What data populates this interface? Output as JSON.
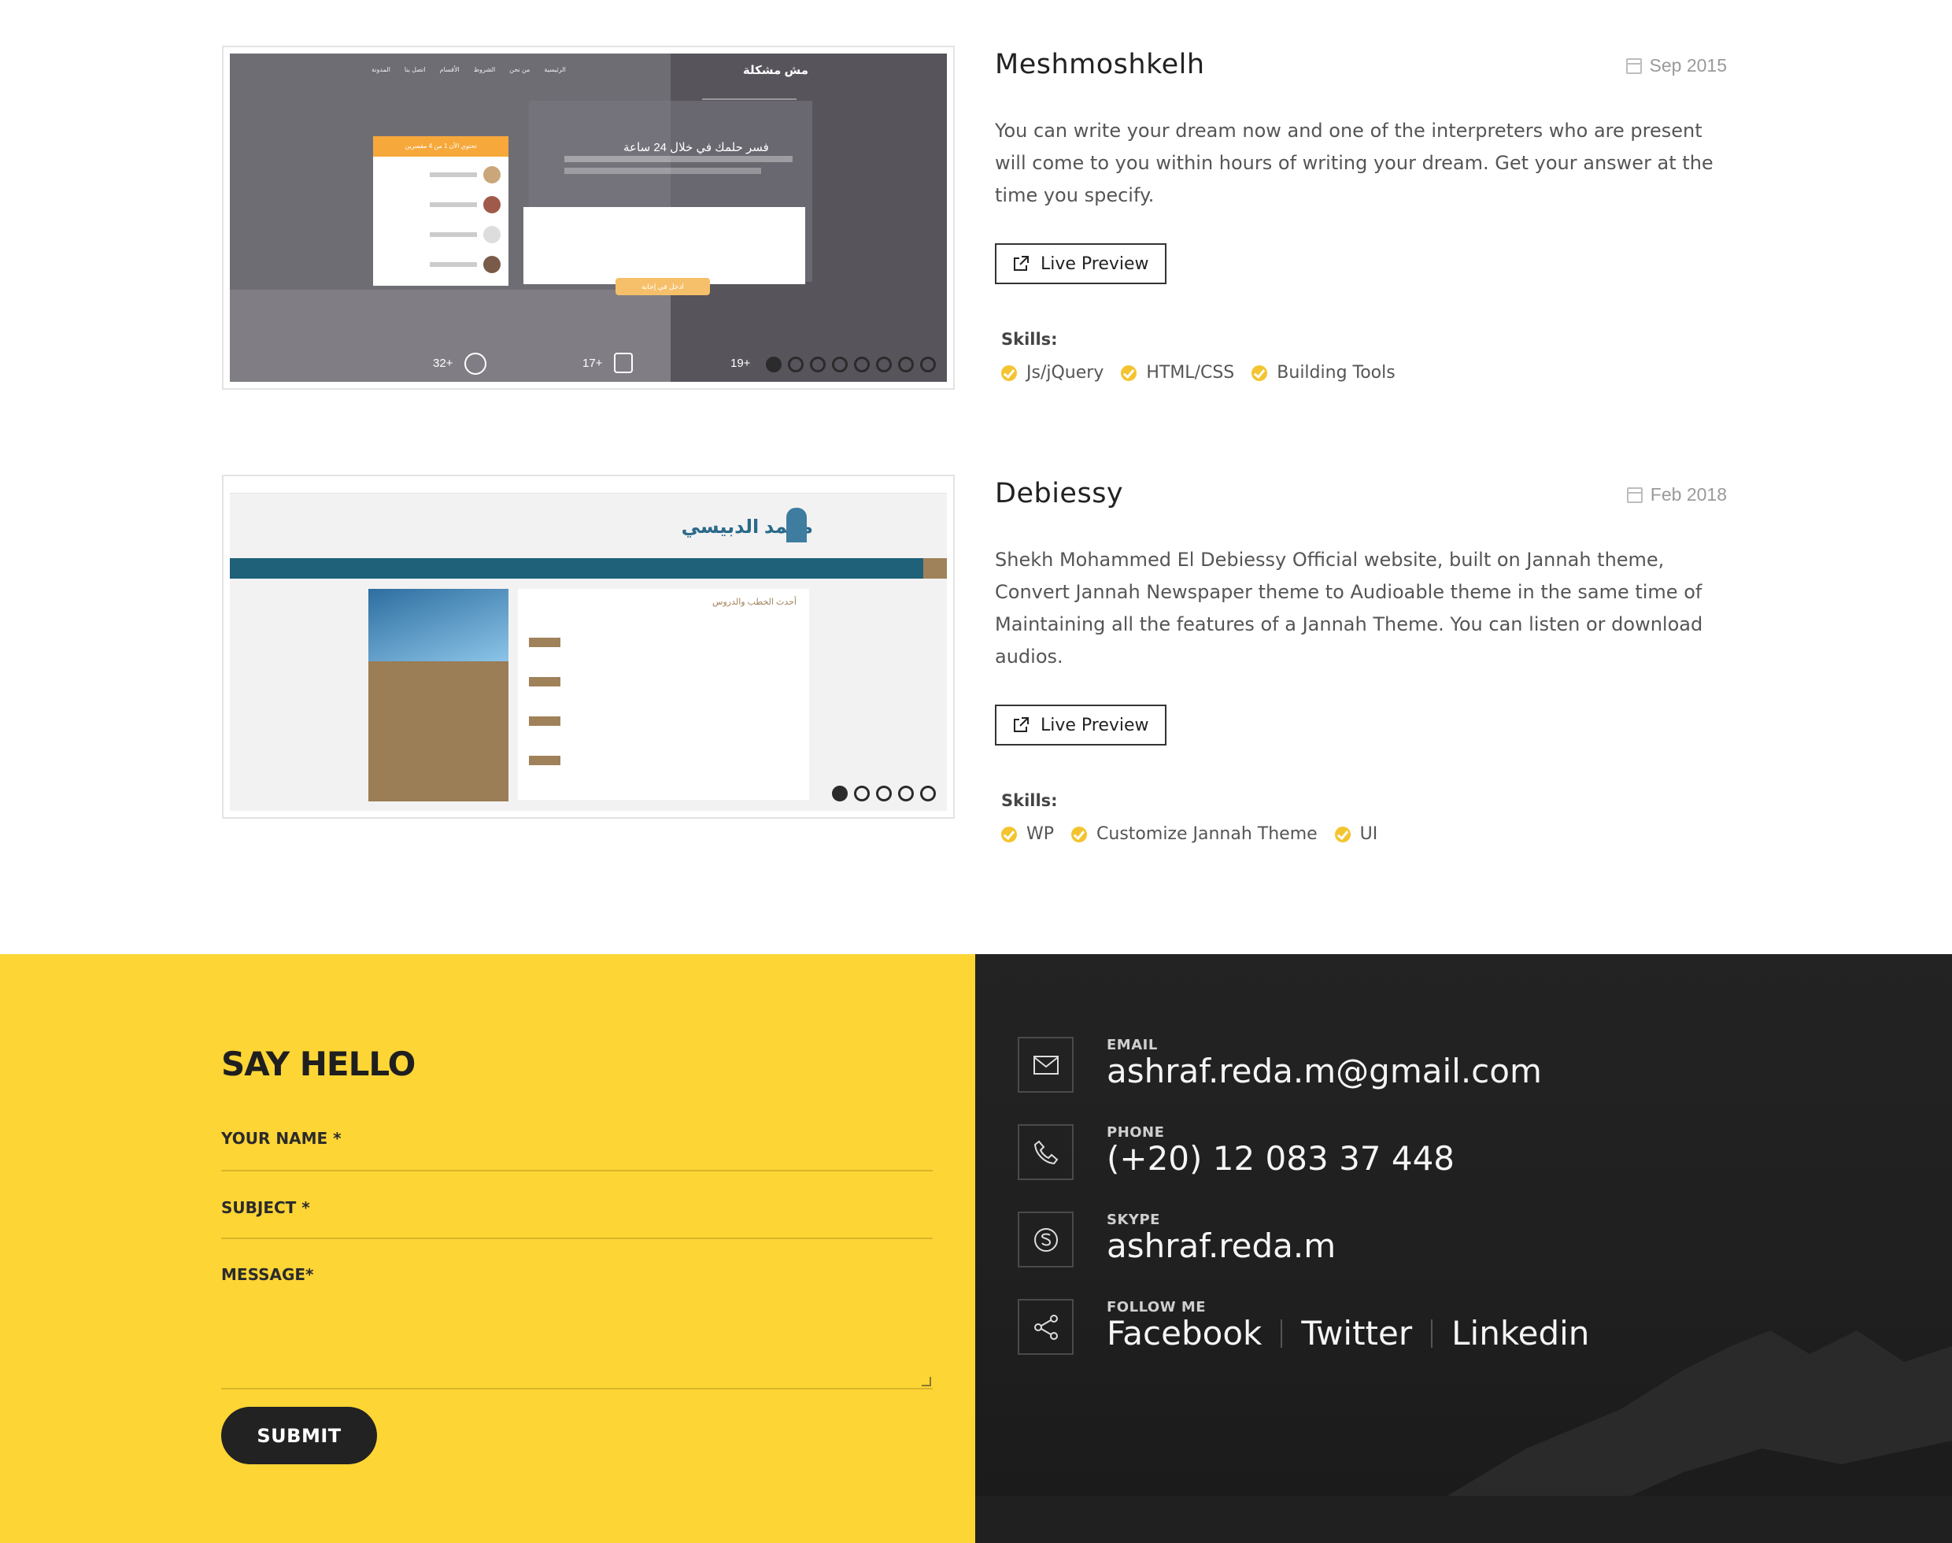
{
  "portfolio": [
    {
      "title": "Meshmoshkelh",
      "date": "Sep 2015",
      "description": "You can write your dream now and one of the interpreters who are present will come to you within hours of writing your dream. Get your answer at the time you specify.",
      "preview_label": "Live Preview",
      "skills_label": "Skills:",
      "skills": [
        "Js/jQuery",
        "HTML/CSS",
        "Building Tools"
      ],
      "screenshot": {
        "logo": "مش مشكلة",
        "nav": [
          "الرئيسية",
          "من نحن",
          "الشروط",
          "الأقسام",
          "اتصل بنا",
          "المدونة"
        ],
        "headline": "فسر حلمك في خلال 24 ساعة",
        "panel_title": "تحتوي الآن 1 من 4 مفسرين",
        "submit": "ادخل في إجابة",
        "stats": [
          "32+",
          "17+",
          "19+"
        ],
        "slide_dots": 8,
        "active_dot": 0
      }
    },
    {
      "title": "Debiessy",
      "date": "Feb 2018",
      "description": "Shekh Mohammed El Debiessy Official website, built on Jannah theme, Convert Jannah Newspaper theme to Audioable theme in the same time of Maintaining all the features of a Jannah Theme. You can listen or download audios.",
      "preview_label": "Live Preview",
      "skills_label": "Skills:",
      "skills": [
        "WP",
        "Customize Jannah Theme",
        "UI"
      ],
      "screenshot": {
        "logo": "محمد الدبيسي",
        "section_title": "أحدث الخطب والدروس",
        "slide_dots": 5,
        "active_dot": 0
      }
    }
  ],
  "contact_form": {
    "heading": "SAY HELLO",
    "name_label": "YOUR NAME *",
    "subject_label": "SUBJECT *",
    "message_label": "MESSAGE*",
    "submit_label": "SUBMIT"
  },
  "contact_info": {
    "email_label": "EMAIL",
    "email": "ashraf.reda.m@gmail.com",
    "phone_label": "PHONE",
    "phone": "(+20) 12 083 37 448",
    "skype_label": "SKYPE",
    "skype": "ashraf.reda.m",
    "follow_label": "FOLLOW ME",
    "socials": [
      "Facebook",
      "Twitter",
      "Linkedin"
    ]
  },
  "colors": {
    "accent": "#fdd535",
    "dark": "#222222",
    "check": "#f4c430"
  }
}
